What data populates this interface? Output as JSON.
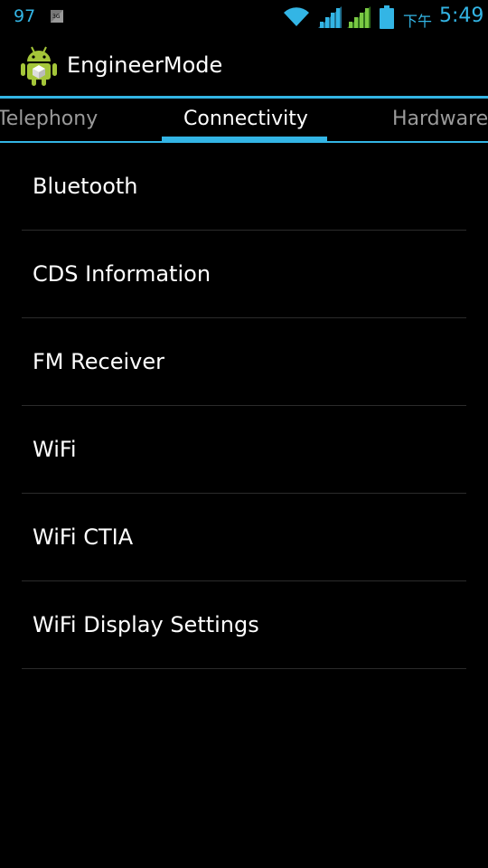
{
  "status_bar": {
    "left_number": "97",
    "ampm": "下午",
    "time": "5:49",
    "icons": [
      "3g-data-icon",
      "wifi-icon",
      "signal-icon",
      "signal-icon",
      "battery-icon"
    ],
    "accent_color": "#33b5e5"
  },
  "action_bar": {
    "title": "EngineerMode",
    "icon": "android-icon"
  },
  "tabs": [
    {
      "label": "Telephony",
      "selected": false
    },
    {
      "label": "Connectivity",
      "selected": true
    },
    {
      "label": "Hardware",
      "selected": false
    }
  ],
  "list": {
    "items": [
      {
        "label": "Bluetooth"
      },
      {
        "label": "CDS Information"
      },
      {
        "label": "FM Receiver"
      },
      {
        "label": "WiFi"
      },
      {
        "label": "WiFi CTIA"
      },
      {
        "label": "WiFi Display Settings"
      }
    ]
  }
}
